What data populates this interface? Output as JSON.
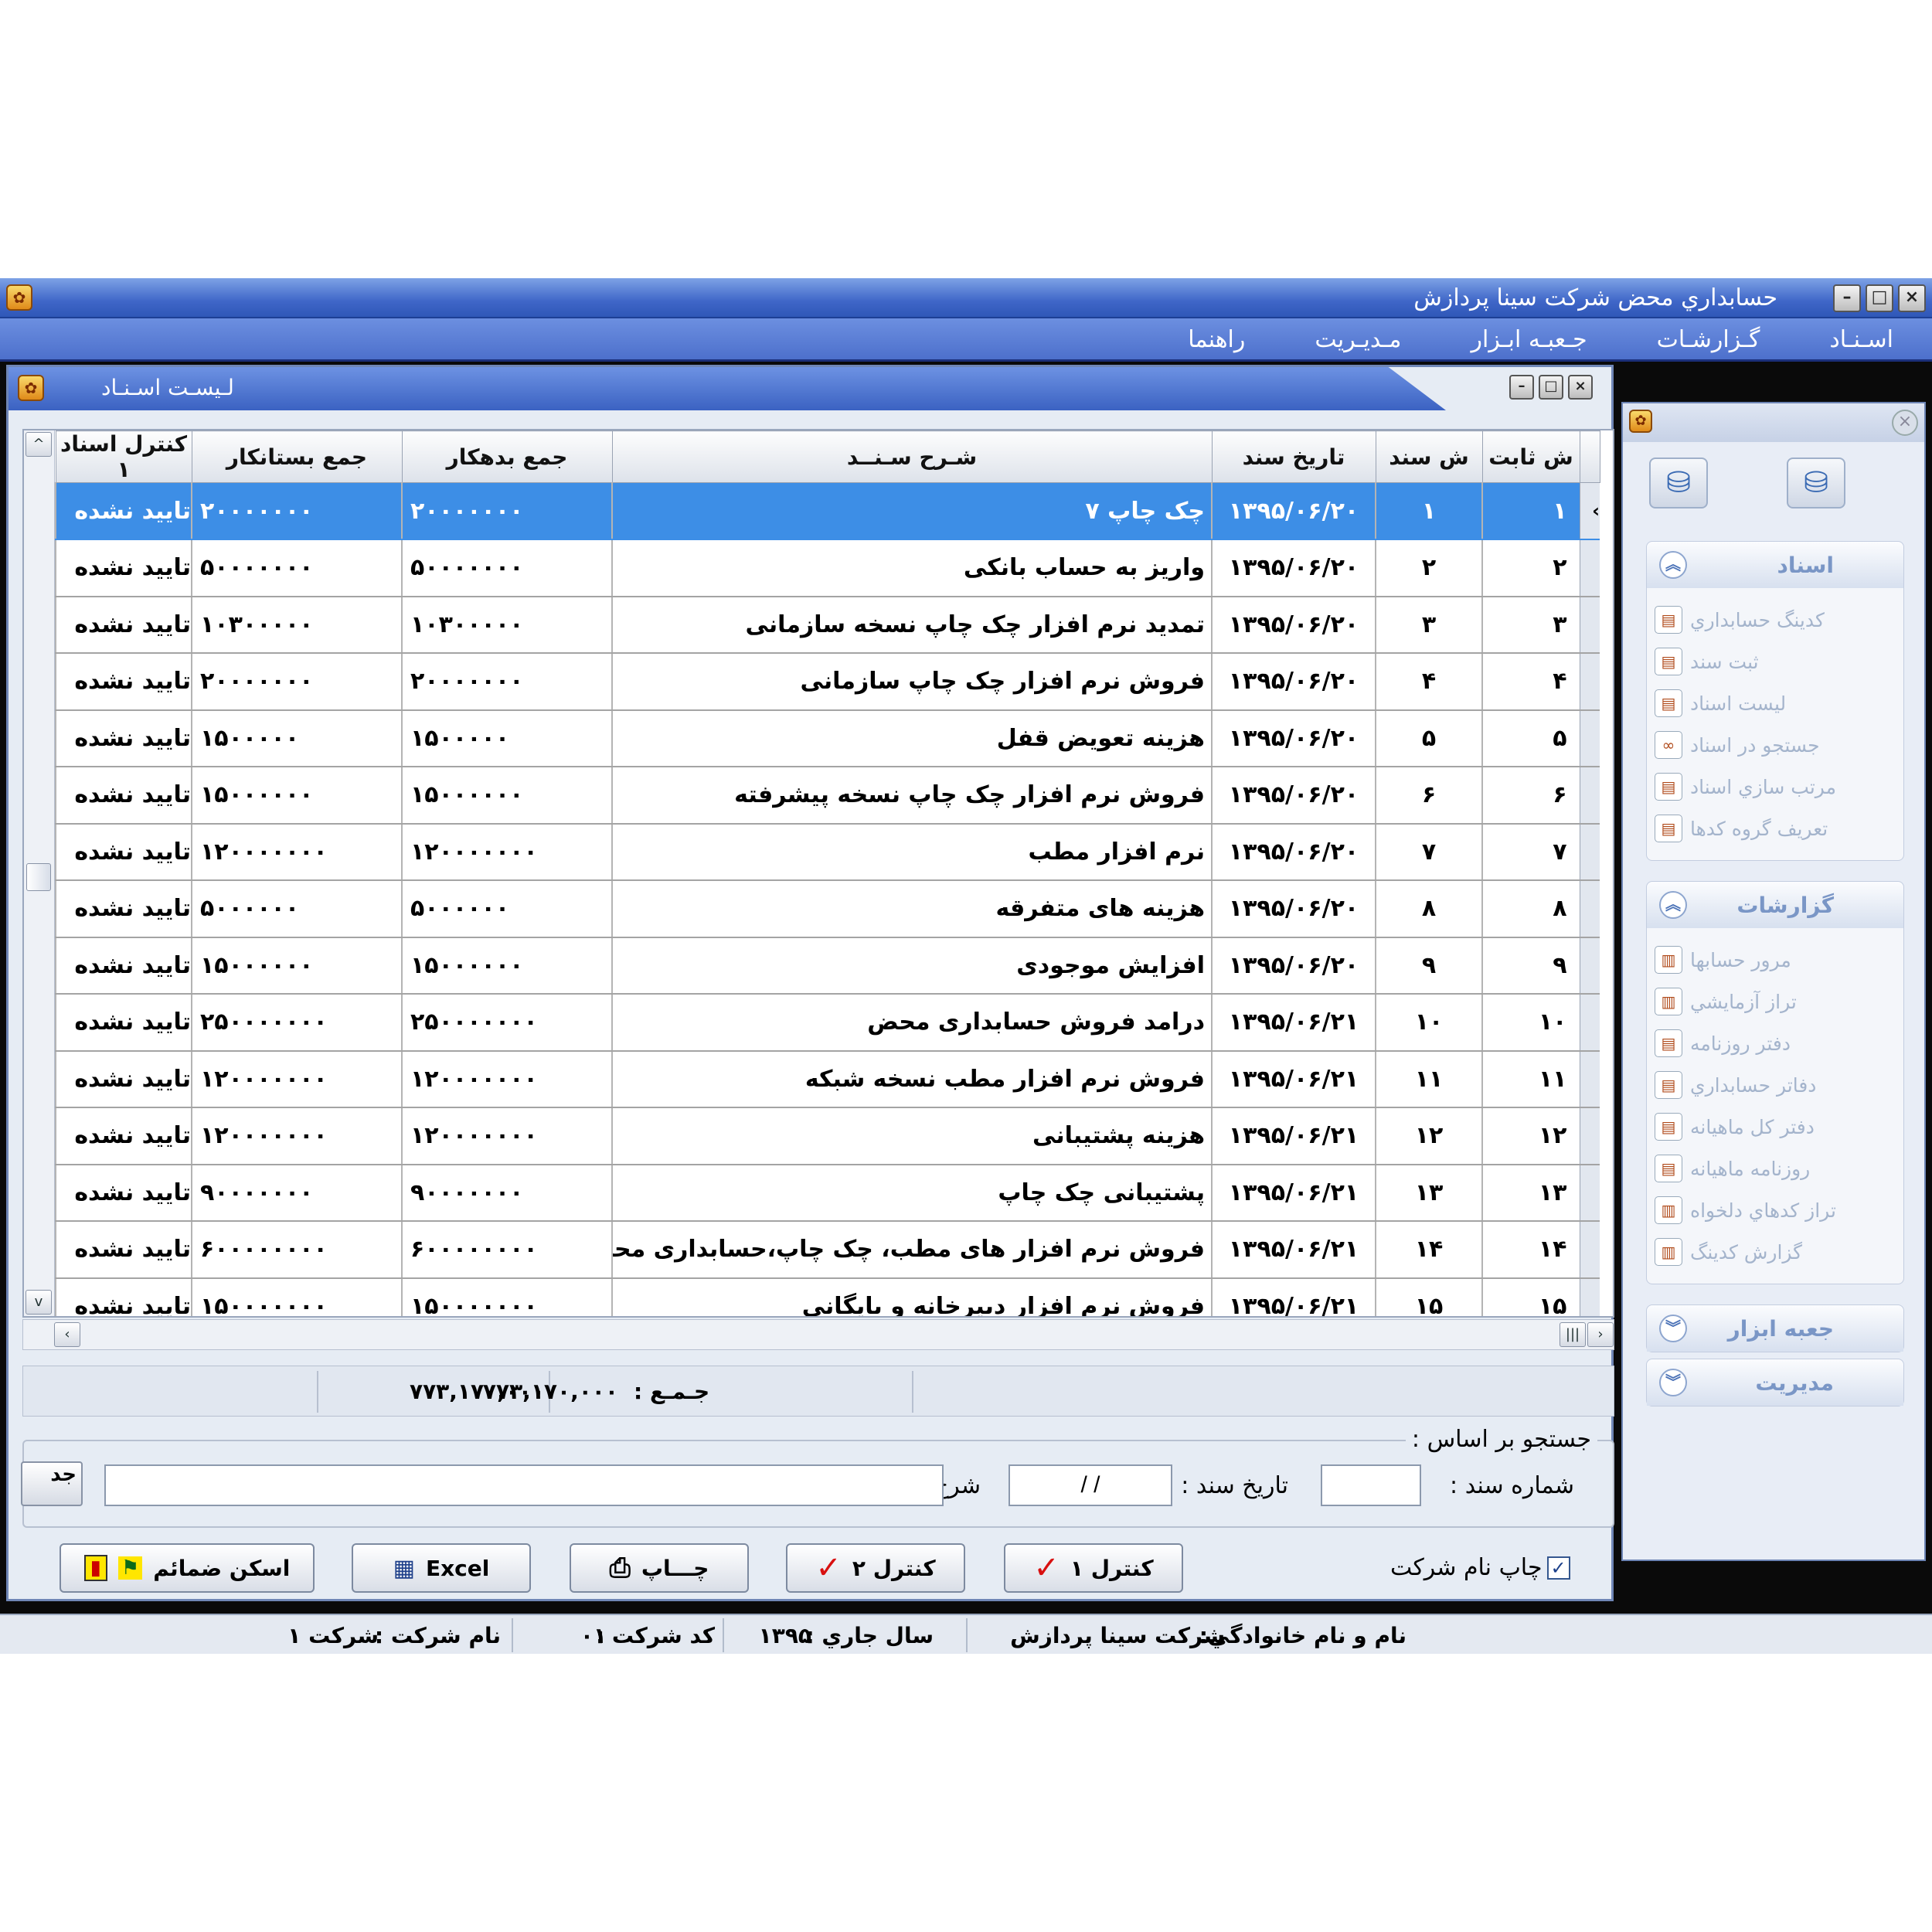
{
  "app": {
    "title": "حسابداري محض شرکت سينا پردازش",
    "logo": ""
  },
  "menu": [
    "اسـنـاد",
    "گـزارشـات",
    "جـعبـه ابـزار",
    "مـديـريت",
    "راهنما"
  ],
  "doc_window": {
    "title": "لـيسـت اسـنـاد"
  },
  "grid": {
    "columns": {
      "fixed_no": "ش ثابت",
      "doc_no": "ش سند",
      "date": "تاريخ سند",
      "desc": "شـرح سـنــد",
      "debit": "جمع بدهکار",
      "credit": "جمع بستانکار",
      "status": "کنترل اسناد ۱"
    },
    "rows": [
      {
        "fixed_no": "۱",
        "doc_no": "۱",
        "date": "۱۳۹۵/۰۶/۲۰",
        "desc": "چک چاپ ۷",
        "debit": "۲۰۰۰۰۰۰۰",
        "credit": "۲۰۰۰۰۰۰۰",
        "status": "تاييد نشده"
      },
      {
        "fixed_no": "۲",
        "doc_no": "۲",
        "date": "۱۳۹۵/۰۶/۲۰",
        "desc": "واريز به حساب بانکی",
        "debit": "۵۰۰۰۰۰۰۰",
        "credit": "۵۰۰۰۰۰۰۰",
        "status": "تاييد نشده"
      },
      {
        "fixed_no": "۳",
        "doc_no": "۳",
        "date": "۱۳۹۵/۰۶/۲۰",
        "desc": "تمديد نرم افزار چک چاپ نسخه سازمانی",
        "debit": "۱۰۳۰۰۰۰۰",
        "credit": "۱۰۳۰۰۰۰۰",
        "status": "تاييد نشده"
      },
      {
        "fixed_no": "۴",
        "doc_no": "۴",
        "date": "۱۳۹۵/۰۶/۲۰",
        "desc": "فروش نرم افزار چک چاپ سازمانی",
        "debit": "۲۰۰۰۰۰۰۰",
        "credit": "۲۰۰۰۰۰۰۰",
        "status": "تاييد نشده"
      },
      {
        "fixed_no": "۵",
        "doc_no": "۵",
        "date": "۱۳۹۵/۰۶/۲۰",
        "desc": "هزينه تعويض قفل",
        "debit": "۱۵۰۰۰۰۰",
        "credit": "۱۵۰۰۰۰۰",
        "status": "تاييد نشده"
      },
      {
        "fixed_no": "۶",
        "doc_no": "۶",
        "date": "۱۳۹۵/۰۶/۲۰",
        "desc": "فروش نرم افزار چک چاپ نسخه پيشرفته",
        "debit": "۱۵۰۰۰۰۰۰",
        "credit": "۱۵۰۰۰۰۰۰",
        "status": "تاييد نشده"
      },
      {
        "fixed_no": "۷",
        "doc_no": "۷",
        "date": "۱۳۹۵/۰۶/۲۰",
        "desc": "نرم افزار مطب",
        "debit": "۱۲۰۰۰۰۰۰۰",
        "credit": "۱۲۰۰۰۰۰۰۰",
        "status": "تاييد نشده"
      },
      {
        "fixed_no": "۸",
        "doc_no": "۸",
        "date": "۱۳۹۵/۰۶/۲۰",
        "desc": "هزينه های متفرقه",
        "debit": "۵۰۰۰۰۰۰",
        "credit": "۵۰۰۰۰۰۰",
        "status": "تاييد نشده"
      },
      {
        "fixed_no": "۹",
        "doc_no": "۹",
        "date": "۱۳۹۵/۰۶/۲۰",
        "desc": "افزايش موجودی",
        "debit": "۱۵۰۰۰۰۰۰",
        "credit": "۱۵۰۰۰۰۰۰",
        "status": "تاييد نشده"
      },
      {
        "fixed_no": "۱۰",
        "doc_no": "۱۰",
        "date": "۱۳۹۵/۰۶/۲۱",
        "desc": "درامد فروش حسابداری محض",
        "debit": "۲۵۰۰۰۰۰۰۰",
        "credit": "۲۵۰۰۰۰۰۰۰",
        "status": "تاييد نشده"
      },
      {
        "fixed_no": "۱۱",
        "doc_no": "۱۱",
        "date": "۱۳۹۵/۰۶/۲۱",
        "desc": "فروش نرم افزار مطب نسخه شبکه",
        "debit": "۱۲۰۰۰۰۰۰۰",
        "credit": "۱۲۰۰۰۰۰۰۰",
        "status": "تاييد نشده"
      },
      {
        "fixed_no": "۱۲",
        "doc_no": "۱۲",
        "date": "۱۳۹۵/۰۶/۲۱",
        "desc": "هزينه پشتيبانی",
        "debit": "۱۲۰۰۰۰۰۰۰",
        "credit": "۱۲۰۰۰۰۰۰۰",
        "status": "تاييد نشده"
      },
      {
        "fixed_no": "۱۳",
        "doc_no": "۱۳",
        "date": "۱۳۹۵/۰۶/۲۱",
        "desc": "پشتيبانی چک چاپ",
        "debit": "۹۰۰۰۰۰۰۰",
        "credit": "۹۰۰۰۰۰۰۰",
        "status": "تاييد نشده"
      },
      {
        "fixed_no": "۱۴",
        "doc_no": "۱۴",
        "date": "۱۳۹۵/۰۶/۲۱",
        "desc": "فروش نرم افزار های مطب، چک چاپ،حسابداری محض و غزال",
        "debit": "۶۰۰۰۰۰۰۰۰",
        "credit": "۶۰۰۰۰۰۰۰۰",
        "status": "تاييد نشده"
      },
      {
        "fixed_no": "۱۵",
        "doc_no": "۱۵",
        "date": "۱۳۹۵/۰۶/۲۱",
        "desc": "فروش نرم افزار دبيرخانه و بايگانی",
        "debit": "۱۵۰۰۰۰۰۰۰",
        "credit": "۱۵۰۰۰۰۰۰۰",
        "status": "تاييد نشده"
      }
    ]
  },
  "totals": {
    "label": "جـمـع :",
    "debit": "۷۷۳,۱۷۰,۰۰۰",
    "credit": "۷۷۳,۱۷۰,۰۰۰"
  },
  "search": {
    "legend": "جستجو بر اساس :",
    "doc_no_label": "شماره سند :",
    "doc_no_value": "",
    "date_label": "تاريخ سند :",
    "date_value": "/ /",
    "desc_label": "شرح سند :",
    "desc_value": "",
    "button": "جد"
  },
  "buttons": {
    "print_company_label": "چاپ نام شرکت",
    "print_company_checked": true,
    "control1": "کنترل ۱",
    "control2": "کنترل ۲",
    "print": "چـــاپ",
    "excel": "Excel",
    "scan": "اسکن ضمائم"
  },
  "nav": {
    "groups": [
      {
        "title": "اسناد",
        "expanded": true,
        "items": [
          {
            "label": "کدينگ حسابداري",
            "icon": "coding-icon"
          },
          {
            "label": "ثبت سند",
            "icon": "register-doc-icon"
          },
          {
            "label": "ليست اسناد",
            "icon": "doc-list-icon"
          },
          {
            "label": "جستجو در اسناد",
            "icon": "binoculars-icon"
          },
          {
            "label": "مرتب سازي اسناد",
            "icon": "sort-icon"
          },
          {
            "label": "تعريف گروه کدها",
            "icon": "add-group-icon"
          }
        ]
      },
      {
        "title": "گزارشات",
        "expanded": true,
        "items": [
          {
            "label": "مرور حسابها",
            "icon": "chart-icon"
          },
          {
            "label": "تراز آزمايشي",
            "icon": "chart-icon"
          },
          {
            "label": "دفتر روزنامه",
            "icon": "journal-icon"
          },
          {
            "label": "دفاتر حسابداري",
            "icon": "ledger-icon"
          },
          {
            "label": "دفتر کل ماهيانه",
            "icon": "book-icon"
          },
          {
            "label": "روزنامه ماهيانه",
            "icon": "journal-icon"
          },
          {
            "label": "تراز کدهاي دلخواه",
            "icon": "chart-icon"
          },
          {
            "label": "گزارش کدينگ",
            "icon": "chart-icon"
          }
        ]
      },
      {
        "title": "جعبه ابزار",
        "expanded": false,
        "items": []
      },
      {
        "title": "مديريت",
        "expanded": false,
        "items": []
      }
    ]
  },
  "status": {
    "user_label": "نام و نام خانوادگي:",
    "user_value": "شرکت سينا پردازش",
    "year_label": "سال جاري :",
    "year_value": "۱۳۹۵",
    "code_label": "کد شرکت :",
    "code_value": "۰۱",
    "company_label": "نام شرکت :",
    "company_value": "شرکت ۱"
  }
}
